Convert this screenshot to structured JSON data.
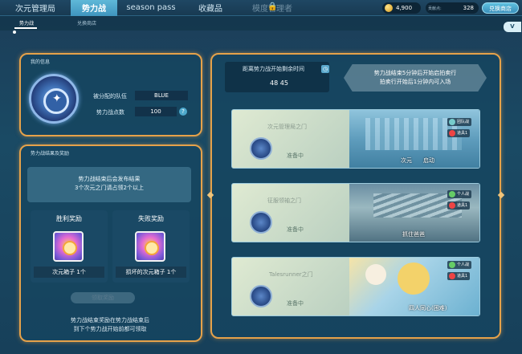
{
  "nav": {
    "tabs": [
      "次元管理局",
      "势力战",
      "season pass",
      "收藏品",
      "模度管理者"
    ],
    "active_tab": "势力战",
    "coins": "4,900",
    "second_currency_label": "贡献点:",
    "second_currency_value": "328",
    "exchange_button": "兑换商店"
  },
  "subnav": {
    "tabs": [
      "势力战",
      "兑换商店"
    ],
    "badge": "V"
  },
  "my_info": {
    "title": "我的信息",
    "team_label": "被分配的队伍",
    "team_value": "BLUE",
    "points_label": "势力战点数",
    "points_value": "100"
  },
  "results": {
    "title": "势力战结果及奖励",
    "note_line1": "势力战结束后会发布结果",
    "note_line2": "3个次元之门请占领2个以上",
    "win_title": "胜利奖励",
    "win_item": "次元箱子 1个",
    "lose_title": "失败奖励",
    "lose_item": "损坏的次元箱子 1个",
    "claim_button": "领取奖励",
    "bottom_line1": "势力战结束奖励在势力战结束后",
    "bottom_line2": "到下个势力战开始前都可领取"
  },
  "timer": {
    "label": "距离势力战开始剩余时间",
    "value": "48 45"
  },
  "auction": {
    "line1": "势力战结束5分钟后开始启拍卖行",
    "line2": "拍卖行开始后1分钟内可入场"
  },
  "gates": [
    {
      "name": "次元管理局之门",
      "status": "准备中",
      "caption": "次元　　启动",
      "badge1": "团队战",
      "badge2": "道具1"
    },
    {
      "name": "征服领袖之门",
      "status": "准备中",
      "caption": "抓住爸爸",
      "badge1": "个人战",
      "badge2": "道具1"
    },
    {
      "name": "Talesrunner之门",
      "status": "准备中",
      "caption": "四人同心(困难)",
      "badge1": "个人战",
      "badge2": "道具1"
    }
  ]
}
